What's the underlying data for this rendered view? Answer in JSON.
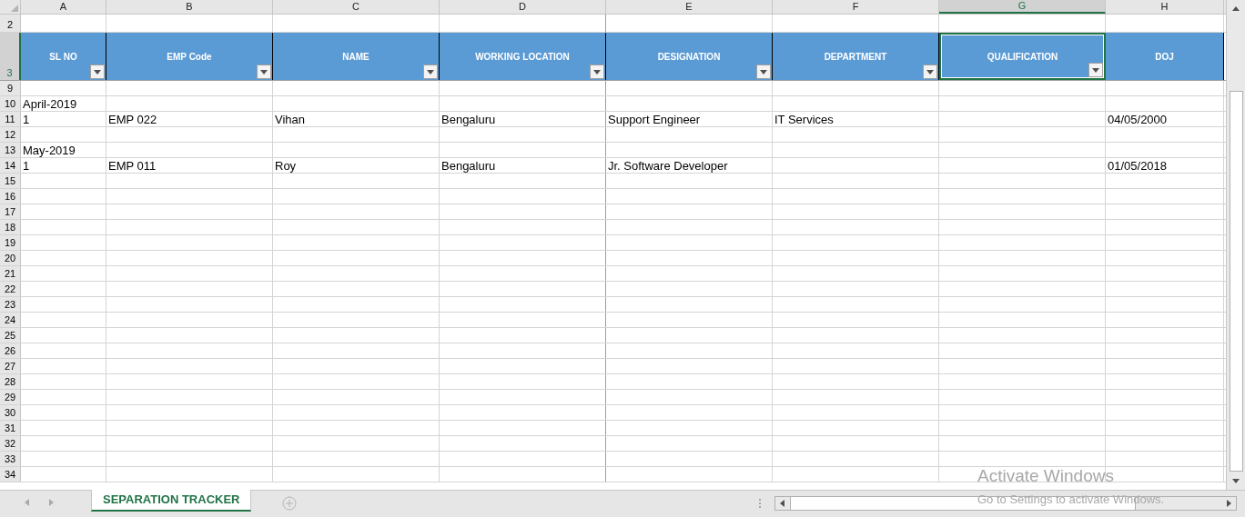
{
  "columns": [
    {
      "letter": "A",
      "header": "SL NO",
      "filter": true,
      "selected": false
    },
    {
      "letter": "B",
      "header": "EMP Code",
      "filter": true,
      "selected": false
    },
    {
      "letter": "C",
      "header": "NAME",
      "filter": true,
      "selected": false
    },
    {
      "letter": "D",
      "header": "WORKING LOCATION",
      "filter": true,
      "selected": false
    },
    {
      "letter": "E",
      "header": "DESIGNATION",
      "filter": true,
      "selected": false
    },
    {
      "letter": "F",
      "header": "DEPARTMENT",
      "filter": true,
      "selected": false
    },
    {
      "letter": "G",
      "header": "QUALIFICATION",
      "filter": true,
      "selected": true
    },
    {
      "letter": "H",
      "header": "DOJ",
      "filter": false,
      "selected": false
    }
  ],
  "rows": [
    {
      "number": "9",
      "cells": []
    },
    {
      "number": "10",
      "cells": [
        "April-2019"
      ]
    },
    {
      "number": "11",
      "cells": [
        "1",
        "EMP  022",
        "Vihan",
        "Bengaluru",
        "Support Engineer",
        "IT Services",
        "",
        "04/05/2000"
      ]
    },
    {
      "number": "12",
      "cells": []
    },
    {
      "number": "13",
      "cells": [
        "May-2019"
      ]
    },
    {
      "number": "14",
      "cells": [
        "1",
        "EMP  011",
        "Roy",
        "Bengaluru",
        "Jr. Software Developer",
        "",
        "",
        "01/05/2018"
      ]
    },
    {
      "number": "15",
      "cells": []
    },
    {
      "number": "16",
      "cells": []
    },
    {
      "number": "17",
      "cells": []
    },
    {
      "number": "18",
      "cells": []
    },
    {
      "number": "19",
      "cells": []
    },
    {
      "number": "20",
      "cells": []
    },
    {
      "number": "21",
      "cells": []
    },
    {
      "number": "22",
      "cells": []
    },
    {
      "number": "23",
      "cells": []
    },
    {
      "number": "24",
      "cells": []
    },
    {
      "number": "25",
      "cells": []
    },
    {
      "number": "26",
      "cells": []
    },
    {
      "number": "27",
      "cells": []
    },
    {
      "number": "28",
      "cells": []
    },
    {
      "number": "29",
      "cells": []
    },
    {
      "number": "30",
      "cells": []
    },
    {
      "number": "31",
      "cells": []
    },
    {
      "number": "32",
      "cells": []
    },
    {
      "number": "33",
      "cells": []
    },
    {
      "number": "34",
      "cells": []
    }
  ],
  "blank_row": {
    "number": "2"
  },
  "header_row": {
    "number": "3",
    "selected": true
  },
  "sheet_tabs": [
    {
      "label": "SEPARATION TRACKER",
      "selected": true
    }
  ],
  "activation_notice": {
    "title": "Activate Windows",
    "message": "Go to Settings to activate Windows."
  }
}
